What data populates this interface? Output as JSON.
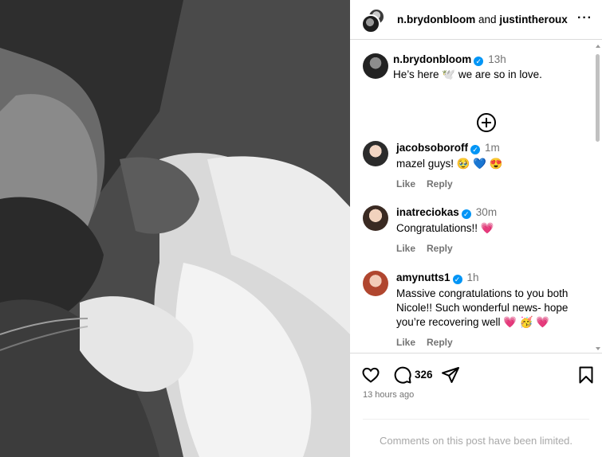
{
  "header": {
    "user1": "n.brydonbloom",
    "joiner": "and",
    "user2": "justintheroux",
    "more": "···"
  },
  "post": {
    "username": "n.brydonbloom",
    "time": "13h",
    "caption": "He’s here 🕊️ we are so in love."
  },
  "comments": [
    {
      "username": "jacobsoboroff",
      "time": "1m",
      "text": "mazel guys! 🥹 💙 😍",
      "like": "Like",
      "reply": "Reply"
    },
    {
      "username": "inatreciokas",
      "time": "30m",
      "text": "Congratulations!! 💗",
      "like": "Like",
      "reply": "Reply"
    },
    {
      "username": "amynutts1",
      "time": "1h",
      "text": "Massive congratulations to you both Nicole!! Such wonderful news- hope you’re recovering well 💗 🥳 💗",
      "like": "Like",
      "reply": "Reply"
    }
  ],
  "footer": {
    "comment_count": "326",
    "posted_ago": "13 hours ago",
    "comments_limited": "Comments on this post have been limited."
  },
  "icons": {
    "like": "heart-icon",
    "comment": "comment-icon",
    "share": "send-icon",
    "save": "bookmark-icon",
    "load_more": "plus-circle-icon"
  },
  "colors": {
    "verified": "#0095f6",
    "muted_text": "#737373",
    "limited_text": "#a8a8a8",
    "border": "#dbdbdb"
  }
}
